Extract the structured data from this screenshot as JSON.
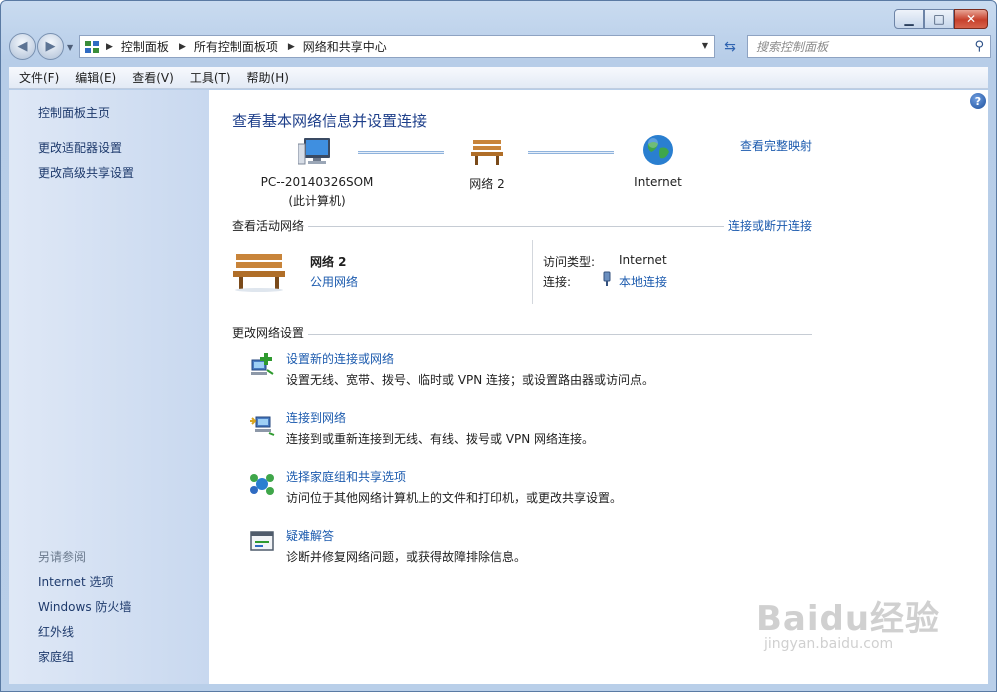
{
  "window": {
    "minimize": "▁",
    "maximize": "□",
    "close": "✕"
  },
  "nav": {
    "back_icon": "back-arrow-icon",
    "forward_icon": "forward-arrow-icon",
    "breadcrumbs": [
      "控制面板",
      "所有控制面板项",
      "网络和共享中心"
    ],
    "search_placeholder": "搜索控制面板"
  },
  "menu": [
    "文件(F)",
    "编辑(E)",
    "查看(V)",
    "工具(T)",
    "帮助(H)"
  ],
  "sidebar": {
    "top_links": [
      "控制面板主页",
      "更改适配器设置",
      "更改高级共享设置"
    ],
    "see_also_heading": "另请参阅",
    "see_also_links": [
      "Internet 选项",
      "Windows 防火墙",
      "红外线",
      "家庭组"
    ]
  },
  "main": {
    "title": "查看基本网络信息并设置连接",
    "view_full_map": "查看完整映射",
    "diagram": {
      "computer_name": "PC--20140326SOM",
      "computer_sub": "(此计算机)",
      "network_name": "网络  2",
      "internet": "Internet"
    },
    "active": {
      "heading": "查看活动网络",
      "connect_link": "连接或断开连接",
      "network_name": "网络  2",
      "network_type": "公用网络",
      "access_label": "访问类型:",
      "access_value": "Internet",
      "connections_label": "连接:",
      "connections_value": "本地连接"
    },
    "change": {
      "heading": "更改网络设置",
      "tasks": [
        {
          "icon": "new-connection-icon",
          "link": "设置新的连接或网络",
          "desc": "设置无线、宽带、拨号、临时或 VPN 连接；或设置路由器或访问点。"
        },
        {
          "icon": "connect-network-icon",
          "link": "连接到网络",
          "desc": "连接到或重新连接到无线、有线、拨号或 VPN 网络连接。"
        },
        {
          "icon": "homegroup-icon",
          "link": "选择家庭组和共享选项",
          "desc": "访问位于其他网络计算机上的文件和打印机，或更改共享设置。"
        },
        {
          "icon": "troubleshoot-icon",
          "link": "疑难解答",
          "desc": "诊断并修复网络问题，或获得故障排除信息。"
        }
      ]
    }
  },
  "watermark": {
    "main": "Baidu经验",
    "sub": "jingyan.baidu.com"
  }
}
